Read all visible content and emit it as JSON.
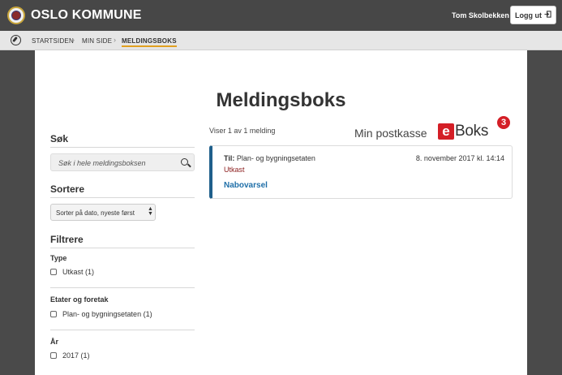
{
  "header": {
    "brand": "OSLO KOMMUNE",
    "user_name": "Tom Skolbekken",
    "logout_label": "Logg ut"
  },
  "breadcrumb": {
    "items": [
      "STARTSIDEN",
      "MIN SIDE",
      "MELDINGSBOKS"
    ],
    "separator": "›"
  },
  "page": {
    "title": "Meldingsboks"
  },
  "sidebar": {
    "search_heading": "Søk",
    "search_placeholder": "Søk i hele meldingsboksen",
    "sort_heading": "Sortere",
    "sort_selected": "Sorter på dato, nyeste først",
    "filter_heading": "Filtrere",
    "filters": [
      {
        "heading": "Type",
        "options": [
          "Utkast (1)"
        ]
      },
      {
        "heading": "Etater og foretak",
        "options": [
          "Plan- og bygningsetaten (1)"
        ]
      },
      {
        "heading": "År",
        "options": [
          "2017 (1)"
        ]
      }
    ]
  },
  "main": {
    "showing_text": "Viser 1 av 1 melding",
    "mailbox_label": "Min postkasse",
    "eboks_e": "e",
    "eboks_word": "Boks",
    "eboks_badge": "3",
    "messages": [
      {
        "to_label": "Til:",
        "to_value": "Plan- og bygningsetaten",
        "date": "8. november 2017 kl. 14:14",
        "status": "Utkast",
        "subject": "Nabovarsel"
      }
    ]
  },
  "colors": {
    "accent_blue": "#1f5f8b",
    "link_blue": "#1f6fa8",
    "status_red": "#8b1c1c",
    "eboks_red": "#d41e26",
    "breadcrumb_underline": "#e0a020"
  }
}
